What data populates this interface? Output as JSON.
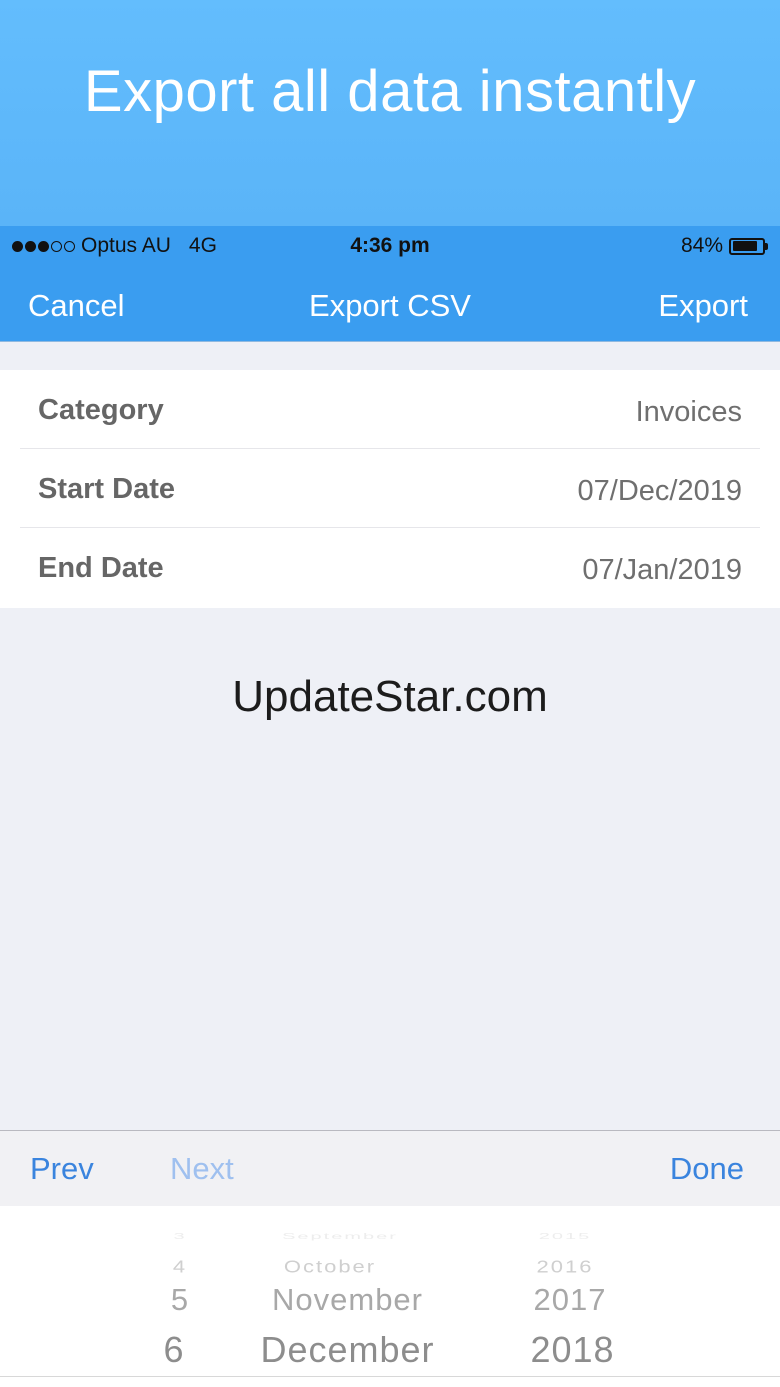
{
  "banner": {
    "title": "Export all data instantly"
  },
  "status_bar": {
    "signal_dots": [
      true,
      true,
      true,
      false,
      false
    ],
    "carrier": "Optus AU",
    "network": "4G",
    "time": "4:36 pm",
    "battery": "84%",
    "battery_level": 0.84
  },
  "nav": {
    "cancel_label": "Cancel",
    "title": "Export CSV",
    "export_label": "Export"
  },
  "form": {
    "rows": [
      {
        "label": "Category",
        "value": "Invoices"
      },
      {
        "label": "Start Date",
        "value": "07/Dec/2019"
      },
      {
        "label": "End Date",
        "value": "07/Jan/2019"
      }
    ]
  },
  "watermark": "UpdateStar.com",
  "toolbar": {
    "prev_label": "Prev",
    "next_label": "Next",
    "done_label": "Done"
  },
  "picker": {
    "days": [
      "3",
      "4",
      "5",
      "6"
    ],
    "months": [
      "September",
      "October",
      "November",
      "December"
    ],
    "years": [
      "2015",
      "2016",
      "2017",
      "2018"
    ]
  },
  "colors": {
    "banner": "#5ab4f8",
    "nav_bar": "#3a9df0",
    "link_blue": "#3a84de",
    "disabled_blue": "#9fc0ef",
    "background": "#eef0f6"
  }
}
